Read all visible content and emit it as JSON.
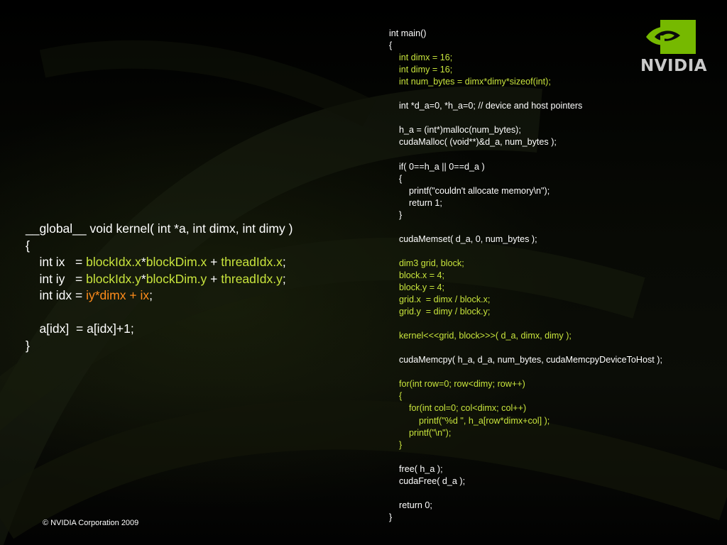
{
  "slide": {
    "logo_text": "NVIDIA",
    "logo_icon": "nvidia-eye-icon",
    "copyright": "© NVIDIA Corporation 2009",
    "colors": {
      "background": "#050505",
      "code_text": "#ffffff",
      "highlight_green": "#c8e43c",
      "highlight_orange": "#ff8c1a",
      "logo_green": "#76b900"
    }
  },
  "kernel_code": [
    [
      {
        "t": "__global__ void kernel( int *a, int dimx, int dimy )",
        "c": "w"
      }
    ],
    [
      {
        "t": "{",
        "c": "w"
      }
    ],
    [
      {
        "t": "    int ix   = ",
        "c": "w"
      },
      {
        "t": "blockIdx.x",
        "c": "g"
      },
      {
        "t": "*",
        "c": "w"
      },
      {
        "t": "blockDim.x",
        "c": "g"
      },
      {
        "t": " + ",
        "c": "w"
      },
      {
        "t": "threadIdx.x",
        "c": "g"
      },
      {
        "t": ";",
        "c": "w"
      }
    ],
    [
      {
        "t": "    int iy   = ",
        "c": "w"
      },
      {
        "t": "blockIdx.y",
        "c": "g"
      },
      {
        "t": "*",
        "c": "w"
      },
      {
        "t": "blockDim.y",
        "c": "g"
      },
      {
        "t": " + ",
        "c": "w"
      },
      {
        "t": "threadIdx.y",
        "c": "g"
      },
      {
        "t": ";",
        "c": "w"
      }
    ],
    [
      {
        "t": "    int idx = ",
        "c": "w"
      },
      {
        "t": "iy*dimx + ix",
        "c": "o"
      },
      {
        "t": ";",
        "c": "w"
      }
    ],
    [
      {
        "t": "",
        "c": "w"
      }
    ],
    [
      {
        "t": "    a[idx]  = a[idx]+1;",
        "c": "w"
      }
    ],
    [
      {
        "t": "}",
        "c": "w"
      }
    ]
  ],
  "main_code": [
    [
      {
        "t": "int main()",
        "c": "w"
      }
    ],
    [
      {
        "t": "{",
        "c": "w"
      }
    ],
    [
      {
        "t": "    int dimx = 16;",
        "c": "g"
      }
    ],
    [
      {
        "t": "    int dimy = 16;",
        "c": "g"
      }
    ],
    [
      {
        "t": "    int num_bytes = dimx*dimy*sizeof(int);",
        "c": "g"
      }
    ],
    [
      {
        "t": "",
        "c": "w"
      }
    ],
    [
      {
        "t": "    int *d_a=0, *h_a=0; // device and host pointers",
        "c": "w"
      }
    ],
    [
      {
        "t": "",
        "c": "w"
      }
    ],
    [
      {
        "t": "    h_a = (int*)malloc(num_bytes);",
        "c": "w"
      }
    ],
    [
      {
        "t": "    cudaMalloc( (void**)&d_a, num_bytes );",
        "c": "w"
      }
    ],
    [
      {
        "t": "",
        "c": "w"
      }
    ],
    [
      {
        "t": "    if( 0==h_a || 0==d_a )",
        "c": "w"
      }
    ],
    [
      {
        "t": "    {",
        "c": "w"
      }
    ],
    [
      {
        "t": "        printf(\"couldn't allocate memory\\n\");",
        "c": "w"
      }
    ],
    [
      {
        "t": "        return 1;",
        "c": "w"
      }
    ],
    [
      {
        "t": "    }",
        "c": "w"
      }
    ],
    [
      {
        "t": "",
        "c": "w"
      }
    ],
    [
      {
        "t": "    cudaMemset( d_a, 0, num_bytes );",
        "c": "w"
      }
    ],
    [
      {
        "t": "",
        "c": "w"
      }
    ],
    [
      {
        "t": "    dim3 grid, block;",
        "c": "g"
      }
    ],
    [
      {
        "t": "    block.x = 4;",
        "c": "g"
      }
    ],
    [
      {
        "t": "    block.y = 4;",
        "c": "g"
      }
    ],
    [
      {
        "t": "    grid.x  = dimx / block.x;",
        "c": "g"
      }
    ],
    [
      {
        "t": "    grid.y  = dimy / block.y;",
        "c": "g"
      }
    ],
    [
      {
        "t": "",
        "c": "w"
      }
    ],
    [
      {
        "t": "    kernel<<<grid, block>>>( d_a, dimx, dimy );",
        "c": "g"
      }
    ],
    [
      {
        "t": "",
        "c": "w"
      }
    ],
    [
      {
        "t": "    cudaMemcpy( h_a, d_a, num_bytes, cudaMemcpyDeviceToHost );",
        "c": "w"
      }
    ],
    [
      {
        "t": "",
        "c": "w"
      }
    ],
    [
      {
        "t": "    for(int row=0; row<dimy; row++)",
        "c": "g"
      }
    ],
    [
      {
        "t": "    {",
        "c": "g"
      }
    ],
    [
      {
        "t": "        for(int col=0; col<dimx; col++)",
        "c": "g"
      }
    ],
    [
      {
        "t": "            printf(\"%d \", h_a[row*dimx+col] );",
        "c": "g"
      }
    ],
    [
      {
        "t": "        printf(\"\\n\");",
        "c": "g"
      }
    ],
    [
      {
        "t": "    }",
        "c": "g"
      }
    ],
    [
      {
        "t": "",
        "c": "w"
      }
    ],
    [
      {
        "t": "    free( h_a );",
        "c": "w"
      }
    ],
    [
      {
        "t": "    cudaFree( d_a );",
        "c": "w"
      }
    ],
    [
      {
        "t": "",
        "c": "w"
      }
    ],
    [
      {
        "t": "    return 0;",
        "c": "w"
      }
    ],
    [
      {
        "t": "}",
        "c": "w"
      }
    ]
  ]
}
